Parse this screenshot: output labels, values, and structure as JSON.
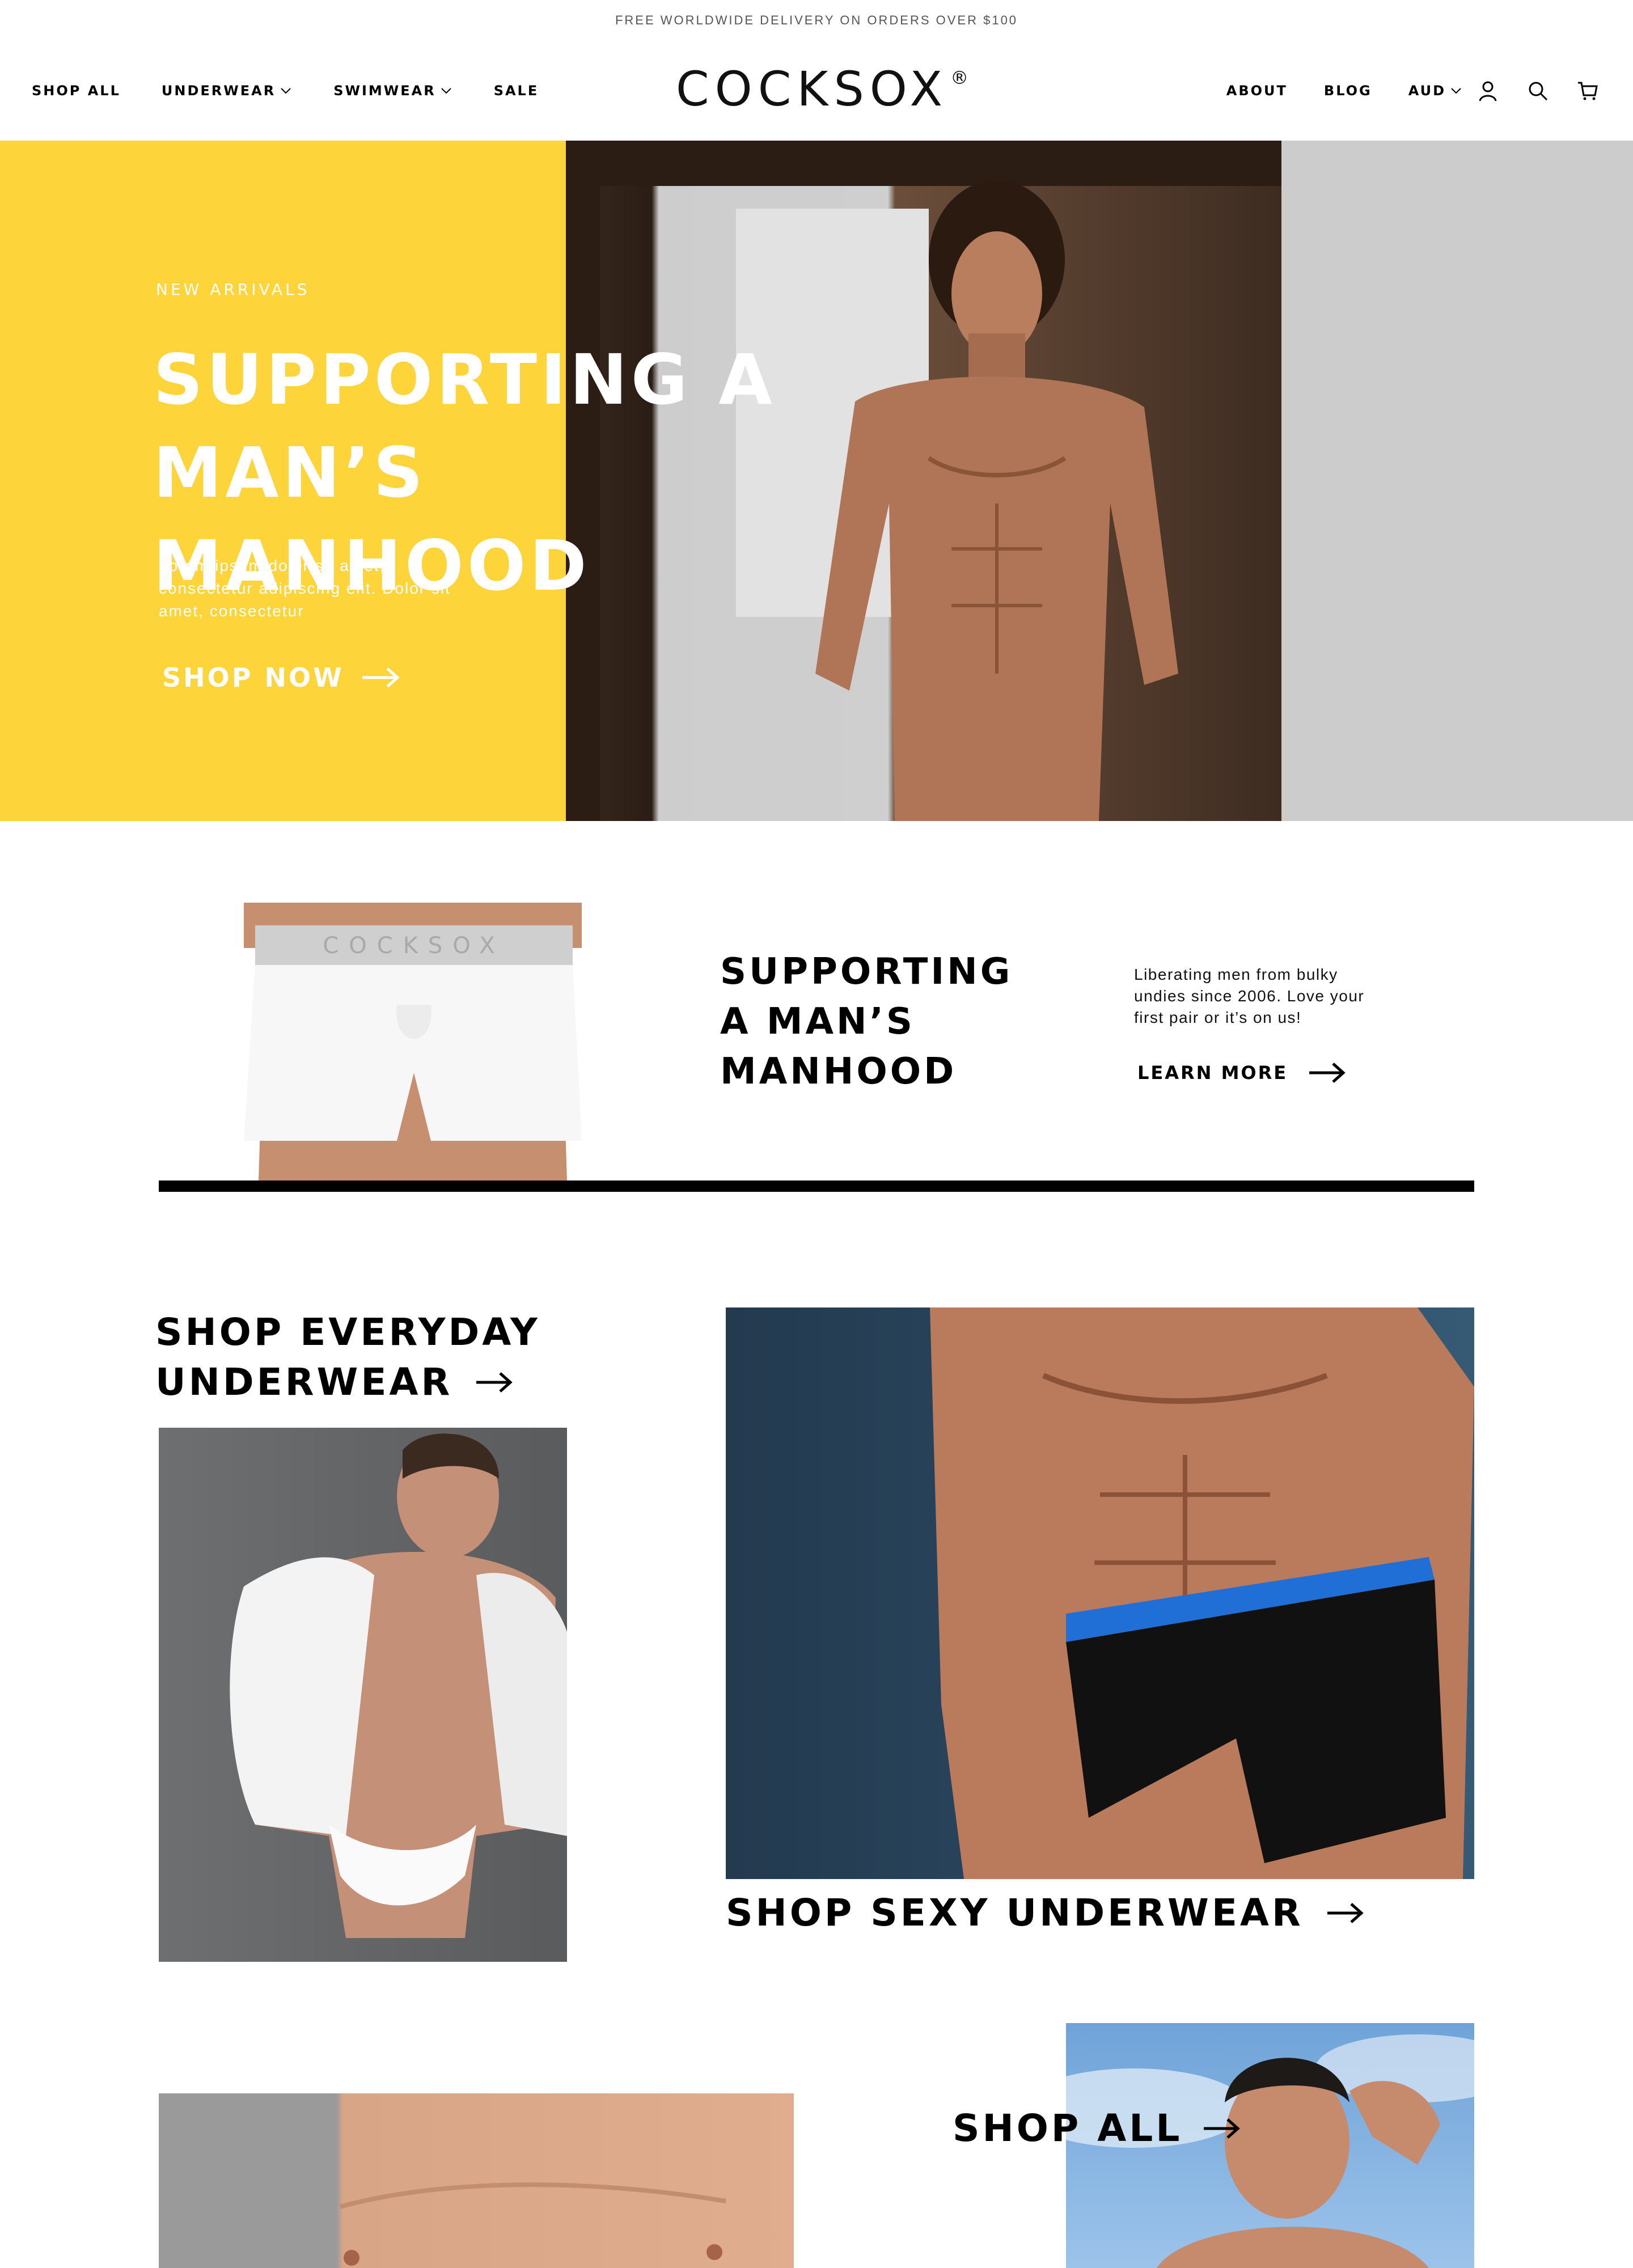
{
  "announcement": "FREE WORLDWIDE DELIVERY ON ORDERS OVER $100",
  "nav": {
    "left": [
      {
        "label": "SHOP ALL",
        "dropdown": false
      },
      {
        "label": "UNDERWEAR",
        "dropdown": true
      },
      {
        "label": "SWIMWEAR",
        "dropdown": true
      },
      {
        "label": "SALE",
        "dropdown": false
      }
    ],
    "logo": "COCKSOX",
    "logo_mark": "®",
    "right": [
      {
        "label": "ABOUT",
        "dropdown": false
      },
      {
        "label": "BLOG",
        "dropdown": false
      },
      {
        "label": "AUD",
        "dropdown": true
      }
    ],
    "icons": [
      "account-icon",
      "search-icon",
      "cart-icon"
    ]
  },
  "hero": {
    "eyebrow": "NEW ARRIVALS",
    "title_line1": "SUPPORTING A",
    "title_line2": "MAN’S MANHOOD",
    "body": "Lorem ipsum dolor sit amet, consectetur adipiscing elit. Dolor sit amet, consectetur",
    "cta": "SHOP NOW",
    "accent_color": "#fdd43a"
  },
  "intro": {
    "title_line1": "SUPPORTING",
    "title_line2": "A MAN’S",
    "title_line3": "MANHOOD",
    "text": "Liberating men from bulky undies since 2006. Love your first pair or it’s on us!",
    "cta": "LEARN MORE",
    "waistband_text": "COCKSOX"
  },
  "categories": {
    "everyday_line1": "SHOP EVERYDAY",
    "everyday_line2": "UNDERWEAR",
    "sexy": "SHOP SEXY UNDERWEAR",
    "all": "SHOP ALL"
  },
  "colors": {
    "announcement_text": "#555555",
    "waistband_blue": "#1f6fd6"
  }
}
